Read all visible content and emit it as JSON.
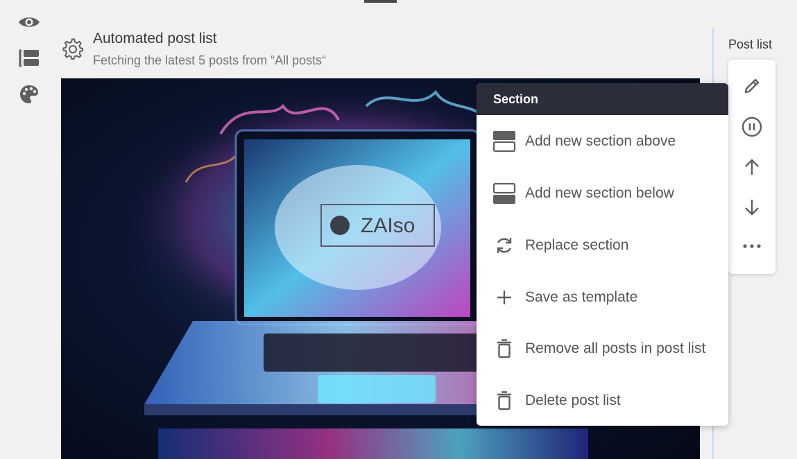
{
  "header": {
    "title": "Automated post list",
    "subtitle": "Fetching the latest 5 posts from “All posts“"
  },
  "left_rail": {
    "icons": [
      "eye-icon",
      "layout-sections-icon",
      "palette-icon"
    ]
  },
  "image": {
    "watermark": "ZAIso"
  },
  "side_panel": {
    "label": "Post list",
    "tools": [
      "pencil-icon",
      "pause-circle-icon",
      "arrow-up-icon",
      "arrow-down-icon",
      "more-horizontal-icon"
    ]
  },
  "menu": {
    "header": "Section",
    "items": [
      {
        "label": "Add new section above",
        "icon": "section-above-icon"
      },
      {
        "label": "Add new section below",
        "icon": "section-below-icon"
      },
      {
        "label": "Replace section",
        "icon": "replace-icon"
      },
      {
        "label": "Save as template",
        "icon": "plus-icon"
      },
      {
        "label": "Remove all posts in post list",
        "icon": "trash-icon"
      },
      {
        "label": "Delete post list",
        "icon": "trash-icon"
      }
    ]
  },
  "colors": {
    "menu_header_bg": "#2c2d3b",
    "icon_gray": "#5f5f5f",
    "divider": "#c9d6ea"
  }
}
